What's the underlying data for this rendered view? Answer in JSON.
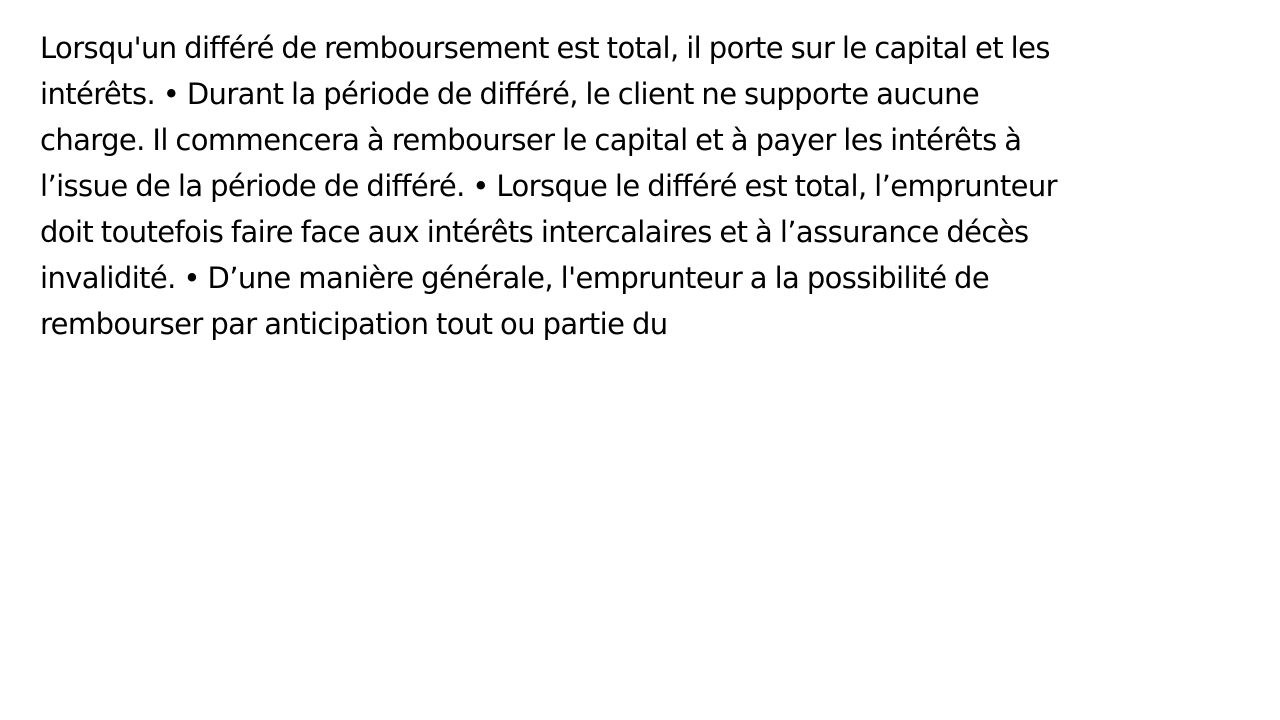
{
  "content": {
    "lines": [
      "Lorsqu'un différé de remboursement est total, il porte sur le capital et les",
      "intérêts. • Durant la période de différé, le client ne supporte aucune",
      "charge. Il commencera à rembourser le capital et à payer les intérêts à",
      "l’issue de la période de différé. • Lorsque le différé est total, l’emprunteur",
      "doit toutefois faire face aux intérêts intercalaires et à l’assurance décès",
      "invalidité. • D’une manière générale, l'emprunteur a la possibilité de",
      "rembourser par anticipation tout ou partie du"
    ]
  },
  "colors": {
    "background": "#ffffff",
    "text": "#000000"
  }
}
